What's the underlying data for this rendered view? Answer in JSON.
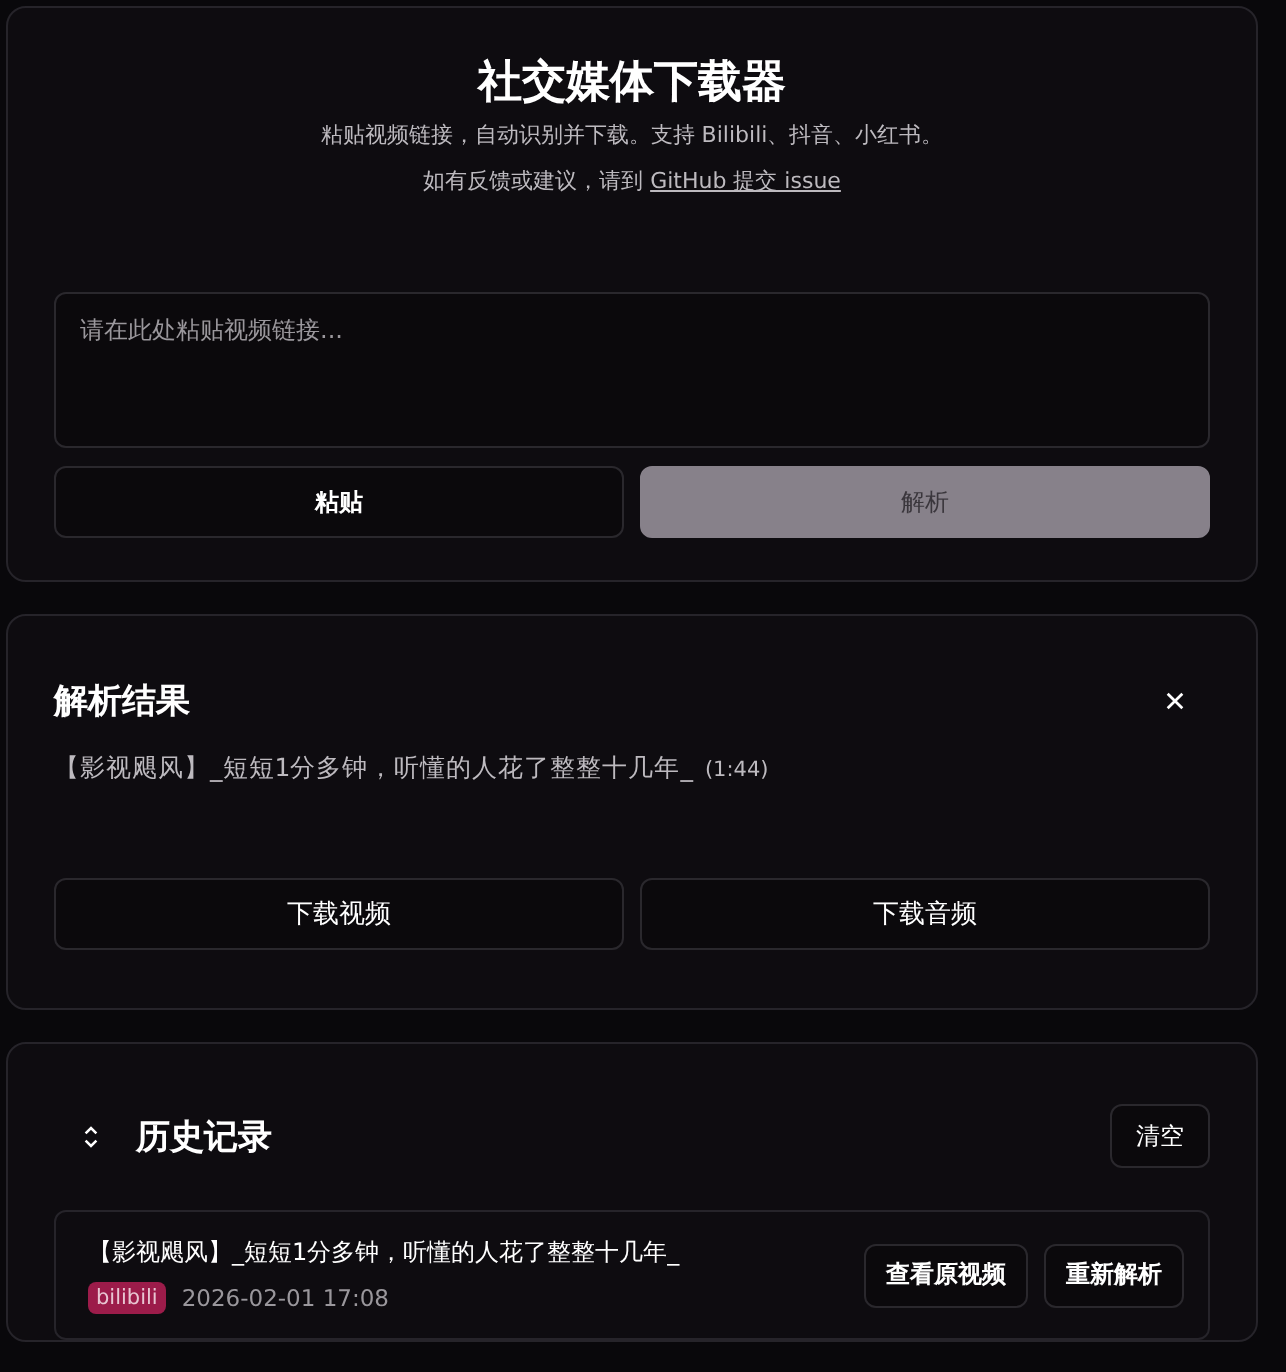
{
  "header": {
    "title": "社交媒体下载器",
    "subtitle": "粘贴视频链接，自动识别并下载。支持 Bilibili、抖音、小红书。",
    "feedback_text": "如有反馈或建议，请到",
    "feedback_link": "GitHub 提交 issue"
  },
  "input": {
    "placeholder": "请在此处粘贴视频链接..."
  },
  "actions": [
    {
      "label": "粘贴",
      "disabled": false
    },
    {
      "label": "解析",
      "disabled": true
    }
  ],
  "result": {
    "title": "解析结果",
    "video_title": "【影视飓风】_短短1分多钟，听懂的人花了整整十几年_",
    "duration": "(1:44)",
    "buttons": [
      "下载视频",
      "下载音频"
    ]
  },
  "history": {
    "title": "历史记录",
    "clear_label": "清空",
    "items": [
      {
        "title": "【影视飓风】_短短1分多钟，听懂的人花了整整十几年_",
        "platform": "bilibili",
        "color": "#9c1c4a",
        "time": "2026-02-01 17:08",
        "buttons": [
          "查看原视频",
          "重新解析"
        ]
      }
    ]
  }
}
